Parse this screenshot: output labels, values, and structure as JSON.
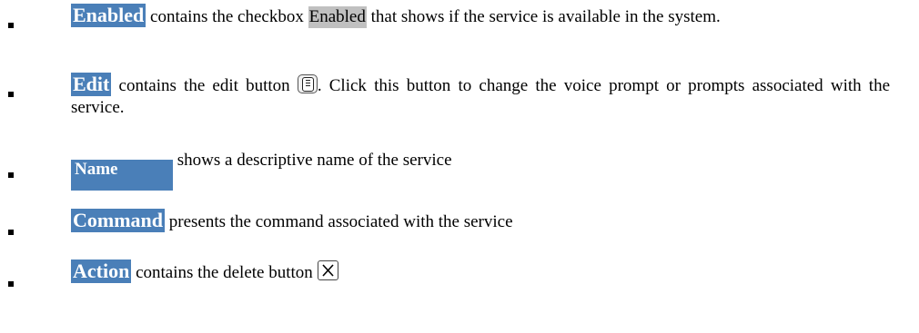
{
  "items": [
    {
      "header": "Enabled",
      "text_before": "contains the checkbox ",
      "inline_label": "Enabled",
      "text_after": " that shows if the service is available in the system."
    },
    {
      "header": "Edit",
      "text_before": "contains the edit button ",
      "icon": "edit-button-icon",
      "text_after": ". Click this button to change the voice prompt or prompts associated with the service."
    },
    {
      "header": "Name",
      "text": "shows a descriptive name of the service"
    },
    {
      "header": "Command",
      "text": "presents the command associated with the service"
    },
    {
      "header": "Action",
      "text_before": "contains the delete button ",
      "icon": "delete-button-icon"
    }
  ],
  "colors": {
    "header_bg": "#4a7fb8",
    "header_text": "#ffffff",
    "checkbox_label_bg": "#c0c0c0"
  }
}
